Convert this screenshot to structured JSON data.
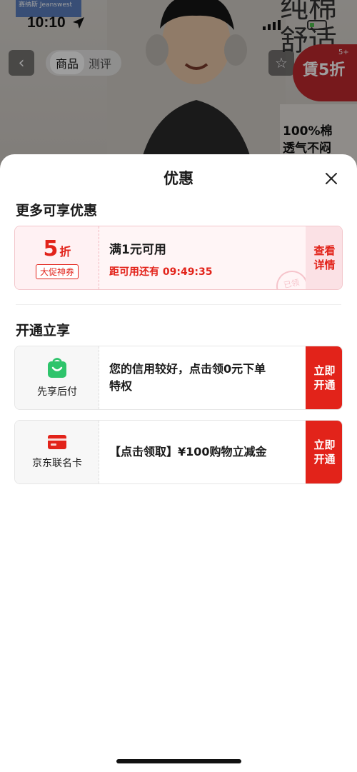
{
  "status_bar": {
    "time": "10:10"
  },
  "background_page": {
    "brand_logo": "赛纳斯 Jeanswest",
    "slogan": [
      "纯棉",
      "舒适"
    ],
    "nav_tabs": [
      "商品",
      "测评"
    ],
    "promo_badge": {
      "text": "賃5折",
      "superscript": "5+"
    },
    "side_card_text": [
      "100%棉",
      "透气不闷"
    ]
  },
  "sheet": {
    "title": "优惠",
    "sections": [
      {
        "title": "更多可享优惠"
      },
      {
        "title": "开通立享"
      }
    ],
    "coupon": {
      "value": "5",
      "unit": "折",
      "tag": "大促神券",
      "condition": "满1元可用",
      "countdown": "距可用还有 09:49:35",
      "action": [
        "查看",
        "详情"
      ],
      "stamp": "已领"
    },
    "services": [
      {
        "name": "先享后付",
        "icon": "shopping-bag-icon",
        "icon_color": "#2ec46b",
        "desc": [
          "您的信用较好，点击领0元下单",
          "特权"
        ],
        "action": [
          "立即",
          "开通"
        ]
      },
      {
        "name": "京东联名卡",
        "icon": "credit-card-icon",
        "icon_color": "#e2231a",
        "desc": [
          "【点击领取】¥100购物立减金"
        ],
        "action": [
          "立即",
          "开通"
        ]
      }
    ]
  },
  "colors": {
    "accent": "#e2231a",
    "coupon_bg": "#fff5f6"
  }
}
